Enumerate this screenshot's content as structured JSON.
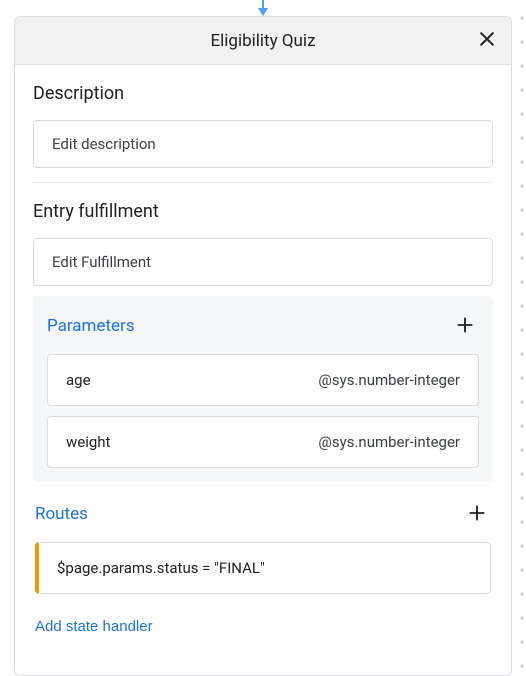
{
  "header": {
    "title": "Eligibility Quiz"
  },
  "description": {
    "heading": "Description",
    "edit_label": "Edit description"
  },
  "entry_fulfillment": {
    "heading": "Entry fulfillment",
    "edit_label": "Edit Fulfillment"
  },
  "parameters": {
    "heading": "Parameters",
    "items": [
      {
        "name": "age",
        "type": "@sys.number-integer"
      },
      {
        "name": "weight",
        "type": "@sys.number-integer"
      }
    ]
  },
  "routes": {
    "heading": "Routes",
    "items": [
      {
        "condition": "$page.params.status = \"FINAL\""
      }
    ]
  },
  "add_state_handler_label": "Add state handler"
}
